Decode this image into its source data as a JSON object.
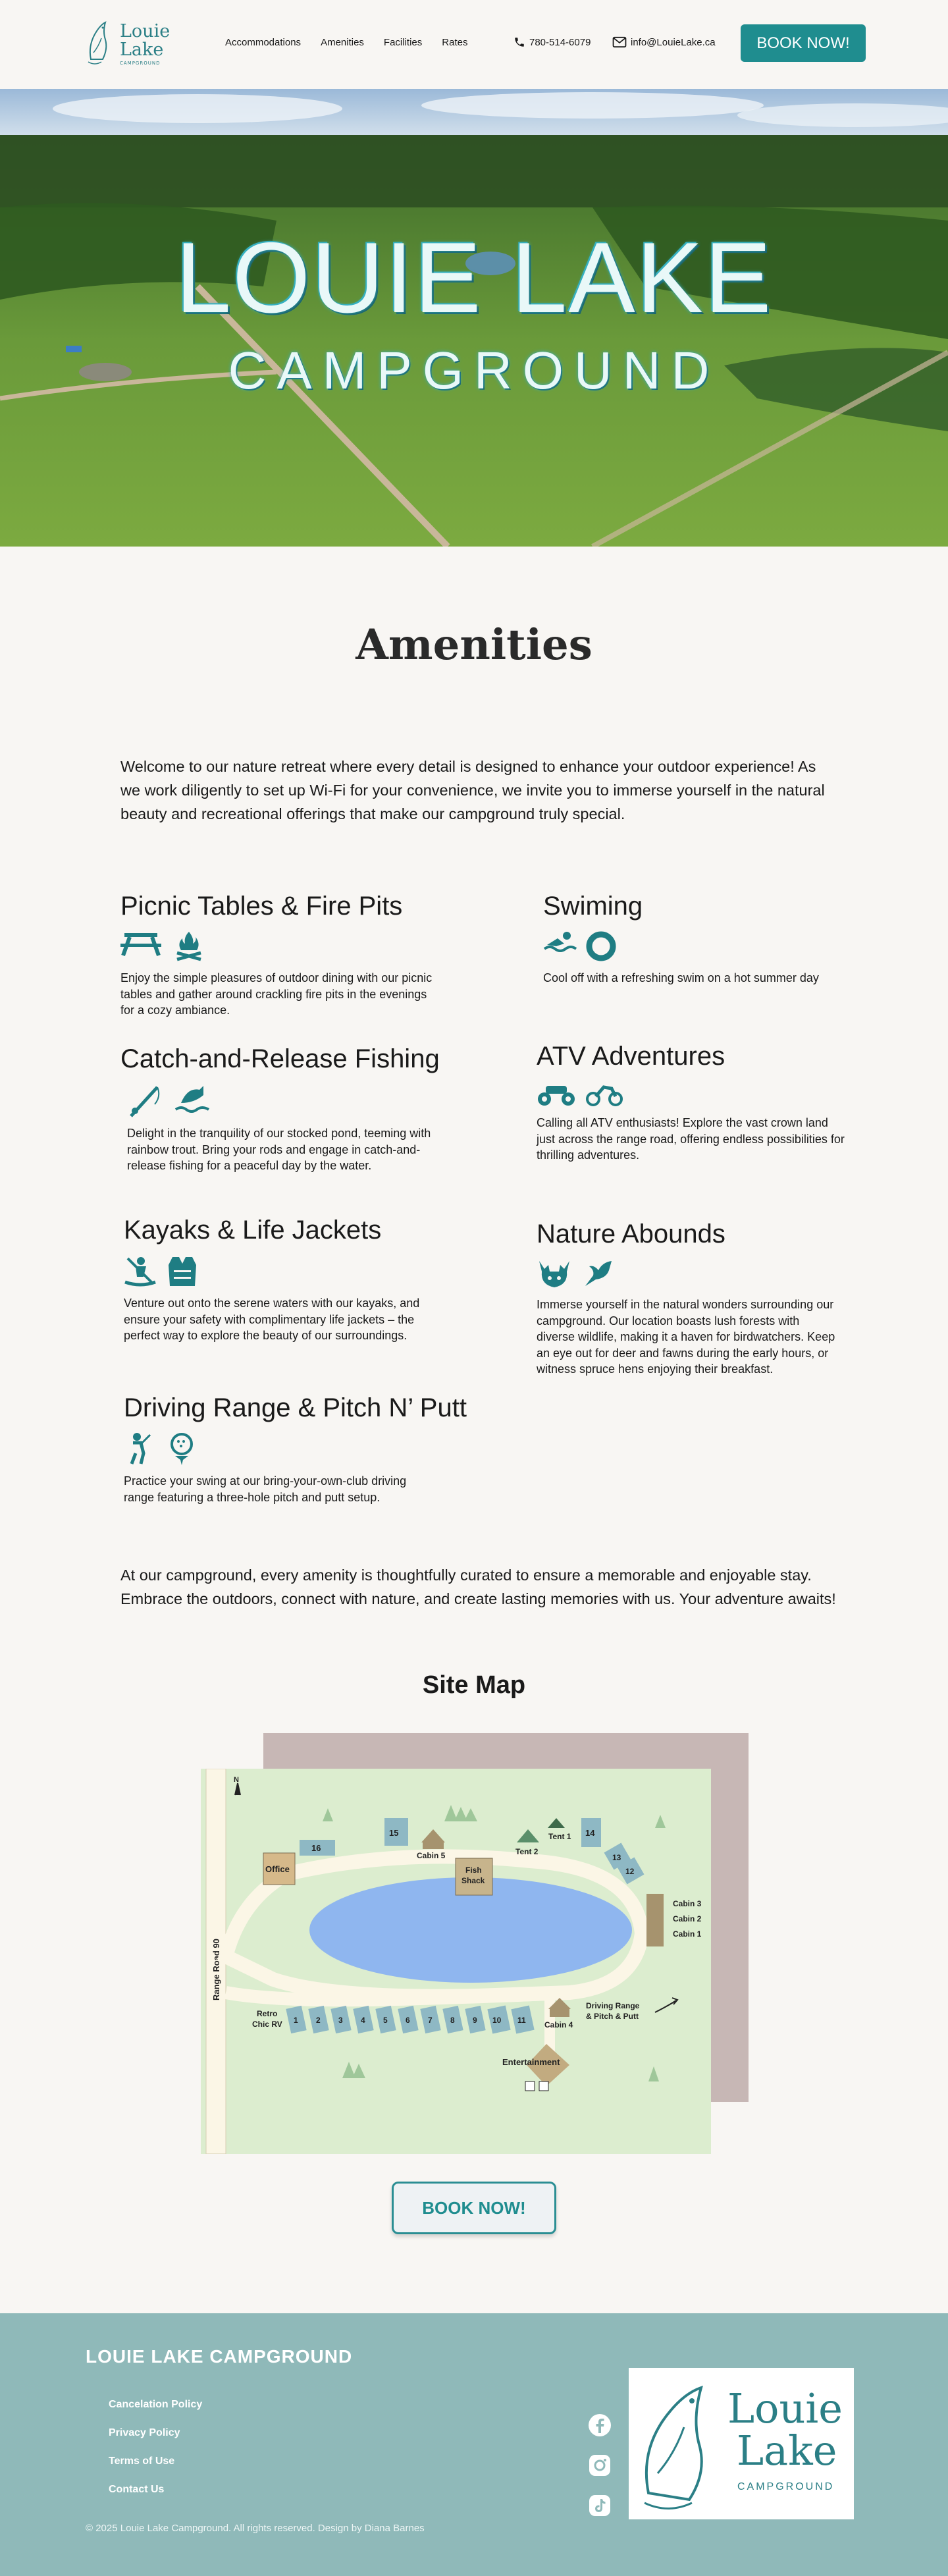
{
  "header": {
    "logo_line1": "Louie",
    "logo_line2": "Lake",
    "logo_sub": "CAMPGROUND",
    "nav": [
      "Accommodations",
      "Amenities",
      "Facilities",
      "Rates"
    ],
    "phone": "780-514-6079",
    "email": "info@LouieLake.ca",
    "book_label": "BOOK NOW!"
  },
  "hero": {
    "title": "LOUIE LAKE",
    "subtitle": "CAMPGROUND"
  },
  "amenities": {
    "title": "Amenities",
    "intro": "Welcome to our nature retreat where every detail is designed to enhance your outdoor experience! As we work diligently to set up Wi-Fi for your convenience, we invite you to immerse yourself in the natural beauty and recreational offerings that make our campground truly special.",
    "items": [
      {
        "title": "Picnic Tables & Fire Pits",
        "text": "Enjoy the simple pleasures of outdoor dining with our picnic tables and gather around crackling fire pits in the evenings for a cozy ambiance."
      },
      {
        "title": "Swiming",
        "text": "Cool off with a refreshing swim on a hot summer day"
      },
      {
        "title": "Catch-and-Release Fishing",
        "text": "Delight in the tranquility of our stocked pond, teeming with rainbow trout. Bring your rods and engage in catch-and-release fishing for a peaceful day by the water."
      },
      {
        "title": "ATV Adventures",
        "text": "Calling all ATV enthusiasts! Explore the vast crown land just across the range road, offering endless possibilities for thrilling adventures."
      },
      {
        "title": "Kayaks & Life Jackets",
        "text": "Venture out onto the serene waters with our kayaks, and ensure your safety with complimentary life jackets – the perfect way to explore the beauty of our surroundings."
      },
      {
        "title": "Nature Abounds",
        "text": "Immerse yourself in the natural wonders surrounding our campground. Our location boasts lush forests with diverse wildlife, making it a haven for birdwatchers. Keep an eye out for deer and fawns during the early hours, or witness spruce hens enjoying their breakfast."
      },
      {
        "title": "Driving Range & Pitch N’ Putt",
        "text": "Practice your swing at our bring-your-own-club driving range featuring a three-hole pitch and putt setup."
      }
    ],
    "closing": "At our campground, every amenity is thoughtfully curated to ensure a memorable and enjoyable stay. Embrace the outdoors, connect with nature, and create lasting memories with us. Your adventure awaits!"
  },
  "site_map": {
    "title": "Site Map",
    "labels": {
      "office": "Office",
      "fish_shack_1": "Fish",
      "fish_shack_2": "Shack",
      "cabin5": "Cabin 5",
      "cabin4": "Cabin 4",
      "cabin3": "Cabin 3",
      "cabin2": "Cabin 2",
      "cabin1": "Cabin 1",
      "tent1": "Tent 1",
      "tent2": "Tent 2",
      "range_road": "Range Road 90",
      "retro_1": "Retro",
      "retro_2": "Chic RV",
      "driving_1": "Driving Range",
      "driving_2": "& Pitch & Putt",
      "entertainment": "Entertainment",
      "north": "N",
      "site_16": "16",
      "site_15": "15",
      "site_14": "14",
      "site_13": "13",
      "site_12": "12",
      "site_1": "1",
      "site_2": "2",
      "site_3": "3",
      "site_4": "4",
      "site_5": "5",
      "site_6": "6",
      "site_7": "7",
      "site_8": "8",
      "site_9": "9",
      "site_10": "10",
      "site_11": "11"
    }
  },
  "book_bottom": "BOOK NOW!",
  "footer": {
    "title": "LOUIE LAKE CAMPGROUND",
    "links": [
      "Cancelation Policy",
      "Privacy Policy",
      "Terms of Use",
      "Contact Us"
    ],
    "copyright": "© 2025 Louie Lake Campground. All rights reserved. Design by Diana Barnes",
    "logo_line1": "Louie",
    "logo_line2": "Lake",
    "logo_sub": "CAMPGROUND"
  },
  "colors": {
    "teal": "#1f8d8f",
    "footer_bg": "#8fb9b9",
    "page_bg": "#f8f6f3"
  }
}
